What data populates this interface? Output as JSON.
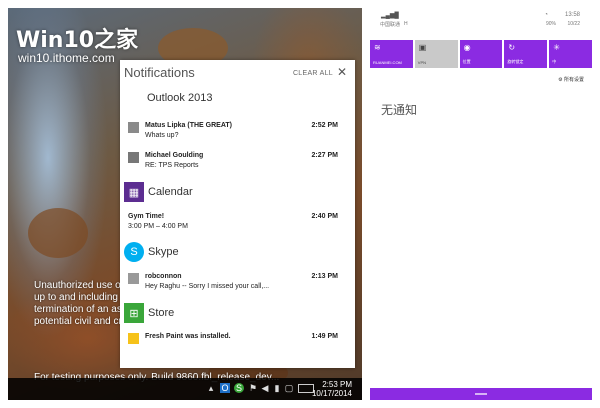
{
  "desktop": {
    "logo": "Win10之家",
    "logo_url": "win10.ithome.com",
    "legal_lines": [
      "Unauthorized use or",
      "up to and including",
      "termination of an ass",
      "potential civil and crin"
    ],
    "build_text": "For testing purposes only. Build 9860.fbl_release_dev...",
    "clock_time": "2:53 PM",
    "clock_date": "10/17/2014"
  },
  "notifications": {
    "title": "Notifications",
    "clear_all": "CLEAR ALL",
    "groups": [
      {
        "app": "Outlook 2013",
        "icon": "outlook-icon",
        "items": [
          {
            "from": "Matus Lipka (THE GREAT)",
            "time": "2:52 PM",
            "body": "Whats up?"
          },
          {
            "from": "Michael Goulding",
            "time": "2:27 PM",
            "body": "RE: TPS Reports"
          }
        ]
      },
      {
        "app": "Calendar",
        "icon": "calendar-icon",
        "color": "#5c2d91",
        "items": [
          {
            "from": "Gym Time!",
            "time": "2:40 PM",
            "body": "3:00 PM – 4:00 PM"
          }
        ]
      },
      {
        "app": "Skype",
        "icon": "skype-icon",
        "color": "#00aff0",
        "items": [
          {
            "from": "robconnon",
            "time": "2:13 PM",
            "body": "Hey Raghu -- Sorry I missed your call,..."
          }
        ]
      },
      {
        "app": "Store",
        "icon": "store-icon",
        "color": "#3aa63a",
        "items": [
          {
            "from": "Fresh Paint was installed.",
            "time": "1:49 PM",
            "body": ""
          }
        ]
      }
    ]
  },
  "phone": {
    "carrier": "中国联通",
    "network": "H",
    "time": "13:58",
    "battery": "90%",
    "date": "10/22",
    "accent": "#8b2be2",
    "tiles": [
      {
        "label": "RUANMEI.COM",
        "icon": "wifi-icon"
      },
      {
        "label": "VPN",
        "icon": "lock-icon"
      },
      {
        "label": "位置",
        "icon": "location-icon"
      },
      {
        "label": "旋转锁定",
        "icon": "rotation-lock-icon"
      },
      {
        "label": "中",
        "icon": "brightness-icon"
      }
    ],
    "all_settings": "所有设置",
    "empty_text": "无通知"
  }
}
